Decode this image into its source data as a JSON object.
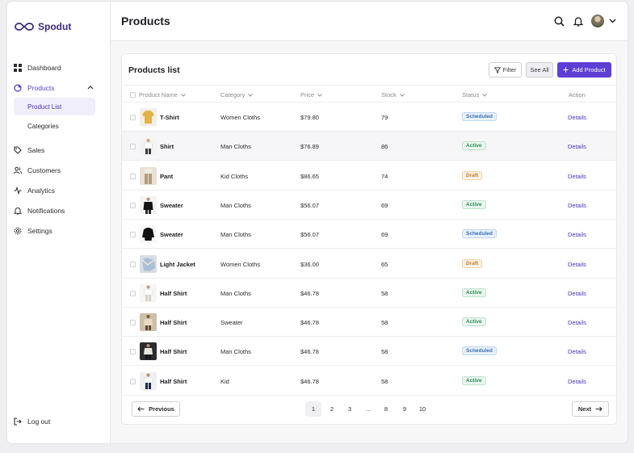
{
  "app": {
    "brand": "Spodut"
  },
  "sidebar": {
    "items": [
      {
        "label": "Dashboard",
        "icon": "grid-icon"
      },
      {
        "label": "Products",
        "icon": "box-icon",
        "expanded": true
      },
      {
        "label": "Sales",
        "icon": "tag-icon"
      },
      {
        "label": "Customers",
        "icon": "users-icon"
      },
      {
        "label": "Analytics",
        "icon": "activity-icon"
      },
      {
        "label": "Notifications",
        "icon": "bell-icon"
      },
      {
        "label": "Settings",
        "icon": "gear-icon"
      }
    ],
    "products_sub": [
      {
        "label": "Product List",
        "selected": true
      },
      {
        "label": "Categories",
        "selected": false
      }
    ],
    "logout_label": "Log out"
  },
  "header": {
    "title": "Products"
  },
  "card": {
    "title": "Products list",
    "filter_label": "Filter",
    "see_all_label": "See All",
    "add_label": "Add Product"
  },
  "table": {
    "columns": [
      "Product Name",
      "Category",
      "Price",
      "Stock",
      "Status",
      "Action"
    ],
    "rows": [
      {
        "name": "T-Shirt",
        "category": "Women Cloths",
        "price": "$79.80",
        "stock": "79",
        "status": "Scheduled",
        "action": "Details"
      },
      {
        "name": "Shirt",
        "category": "Man Cloths",
        "price": "$76.89",
        "stock": "86",
        "status": "Active",
        "action": "Details"
      },
      {
        "name": "Pant",
        "category": "Kid Cloths",
        "price": "$86.65",
        "stock": "74",
        "status": "Draft",
        "action": "Details"
      },
      {
        "name": "Sweater",
        "category": "Man Cloths",
        "price": "$56.07",
        "stock": "69",
        "status": "Active",
        "action": "Details"
      },
      {
        "name": "Sweater",
        "category": "Man Cloths",
        "price": "$56.07",
        "stock": "69",
        "status": "Scheduled",
        "action": "Details"
      },
      {
        "name": "Light Jacket",
        "category": "Women Cloths",
        "price": "$36.00",
        "stock": "65",
        "status": "Draft",
        "action": "Details"
      },
      {
        "name": "Half Shirt",
        "category": "Man Cloths",
        "price": "$46.78",
        "stock": "58",
        "status": "Active",
        "action": "Details"
      },
      {
        "name": "Half Shirt",
        "category": "Sweater",
        "price": "$46.78",
        "stock": "58",
        "status": "Active",
        "action": "Details"
      },
      {
        "name": "Half Shirt",
        "category": "Man Cloths",
        "price": "$46.78",
        "stock": "58",
        "status": "Scheduled",
        "action": "Details"
      },
      {
        "name": "Half Shirt",
        "category": "Kid",
        "price": "$46.78",
        "stock": "58",
        "status": "Active",
        "action": "Details"
      }
    ]
  },
  "pagination": {
    "previous_label": "Previous",
    "next_label": "Next",
    "pages": [
      "1",
      "2",
      "3",
      "...",
      "8",
      "9",
      "10"
    ],
    "current": "1"
  },
  "colors": {
    "accent": "#5d3fd3",
    "active": "#2f8a53",
    "scheduled": "#3c6fb0",
    "draft": "#c27a2a"
  }
}
